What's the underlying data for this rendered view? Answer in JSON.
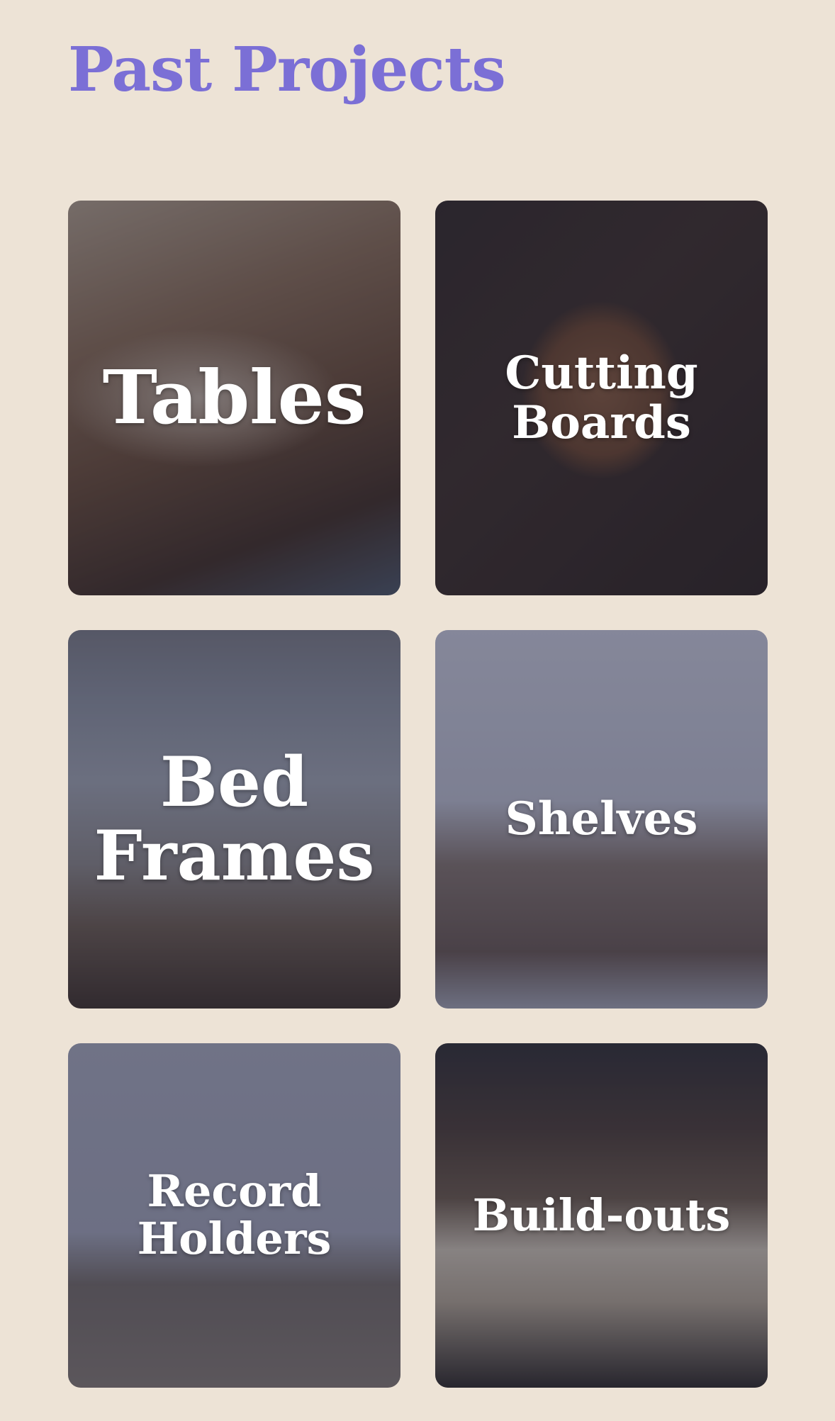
{
  "header": {
    "title": "Past Projects"
  },
  "projects": [
    {
      "label": "Tables"
    },
    {
      "label": "Cutting\nBoards"
    },
    {
      "label": "Bed\nFrames"
    },
    {
      "label": "Shelves"
    },
    {
      "label": "Record\nHolders"
    },
    {
      "label": "Build-outs"
    }
  ],
  "colors": {
    "background": "#ede3d6",
    "title": "#7b6fd6",
    "card_text": "#ffffff"
  }
}
